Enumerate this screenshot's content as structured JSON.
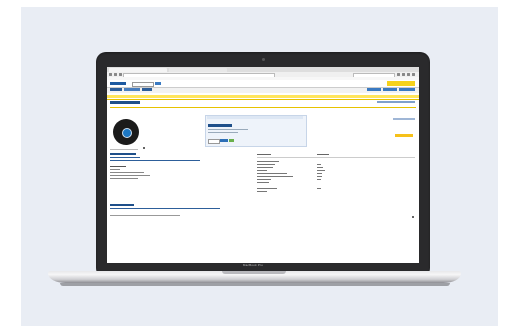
{
  "device": {
    "model_label": "MacBook Pro"
  },
  "colors": {
    "background_panel": "#e9edf4",
    "bezel": "#2a2a2c",
    "brand_blue": "#1e4f8a",
    "brand_yellow": "#f6d21b"
  }
}
